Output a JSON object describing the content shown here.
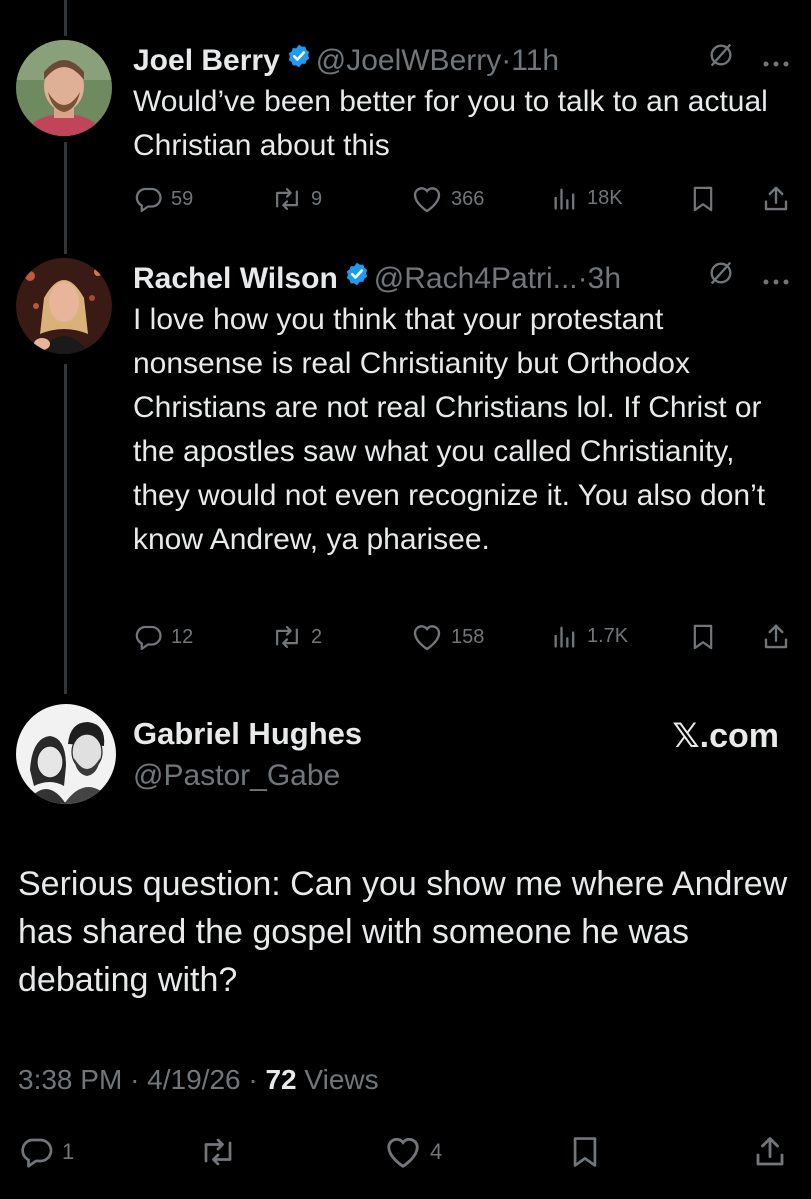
{
  "replies": [
    {
      "name": "Joel Berry",
      "handle": "@JoelWBerry",
      "sep": "·",
      "time": "11h",
      "text": "Would’ve been better for you to talk to an actual Christian about this",
      "stats": {
        "replies": "59",
        "reposts": "9",
        "likes": "366",
        "views": "18K"
      }
    },
    {
      "name": "Rachel Wilson",
      "handle": "@Rach4Patri...",
      "sep": "·",
      "time": "3h",
      "text": "I love how you think that your protestant nonsense is real Christianity but Orthodox Christians are not real Christians lol. If Christ or the apostles saw what you called Christianity, they would not even recognize it. You also don’t know Andrew, ya pharisee.",
      "stats": {
        "replies": "12",
        "reposts": "2",
        "likes": "158",
        "views": "1.7K"
      }
    }
  ],
  "main": {
    "name": "Gabriel Hughes",
    "handle": "@Pastor_Gabe",
    "brand": "𝕏.com",
    "text": "Serious question: Can you show me where Andrew has shared the gospel with someone he was debating with?",
    "time": "3:38 PM",
    "date": "4/19/26",
    "views_count": "72",
    "views_label": "Views",
    "sep": "·",
    "stats": {
      "replies": "1",
      "likes": "4"
    }
  },
  "colors": {
    "accent": "#1d9bf0",
    "muted": "#71767b",
    "text": "#e7e9ea",
    "background": "#000000"
  }
}
